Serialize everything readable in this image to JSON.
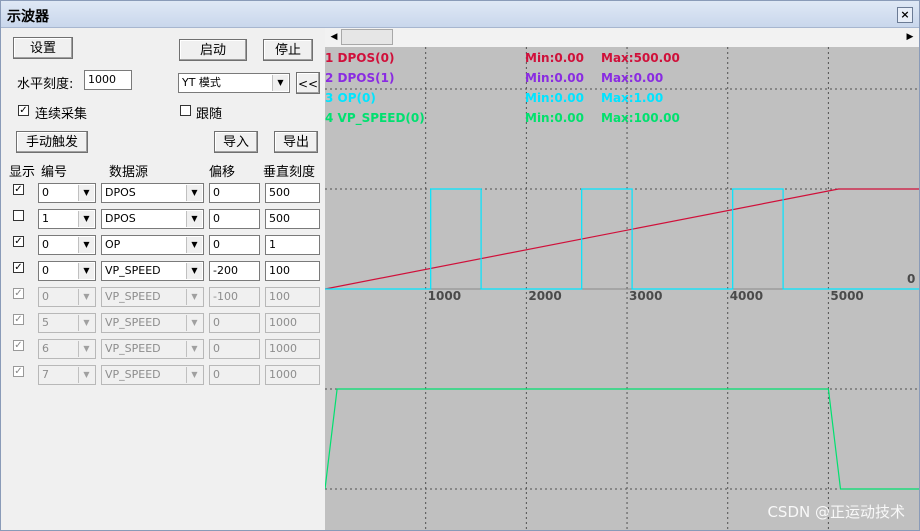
{
  "window": {
    "title": "示波器",
    "close_label": "×"
  },
  "toolbar": {
    "settings_label": "设置",
    "start_label": "启动",
    "stop_label": "停止",
    "h_scale_label": "水平刻度:",
    "h_scale_value": "1000",
    "mode_value": "YT 模式",
    "collapse_label": "<<",
    "continuous_label": "连续采集",
    "continuous_checked": true,
    "follow_label": "跟随",
    "follow_checked": false,
    "manual_trigger_label": "手动触发",
    "import_label": "导入",
    "export_label": "导出"
  },
  "columns": {
    "show": "显示",
    "num": "编号",
    "source": "数据源",
    "offset": "偏移",
    "scale": "垂直刻度"
  },
  "channels": [
    {
      "show": true,
      "num": "0",
      "source": "DPOS",
      "offset": "0",
      "scale": "500",
      "enabled": true
    },
    {
      "show": false,
      "num": "1",
      "source": "DPOS",
      "offset": "0",
      "scale": "500",
      "enabled": true
    },
    {
      "show": true,
      "num": "0",
      "source": "OP",
      "offset": "0",
      "scale": "1",
      "enabled": true
    },
    {
      "show": true,
      "num": "0",
      "source": "VP_SPEED",
      "offset": "-200",
      "scale": "100",
      "enabled": true
    },
    {
      "show": true,
      "num": "0",
      "source": "VP_SPEED",
      "offset": "-100",
      "scale": "100",
      "enabled": false
    },
    {
      "show": true,
      "num": "5",
      "source": "VP_SPEED",
      "offset": "0",
      "scale": "1000",
      "enabled": false
    },
    {
      "show": true,
      "num": "6",
      "source": "VP_SPEED",
      "offset": "0",
      "scale": "1000",
      "enabled": false
    },
    {
      "show": true,
      "num": "7",
      "source": "VP_SPEED",
      "offset": "0",
      "scale": "1000",
      "enabled": false
    }
  ],
  "legend": [
    {
      "name": "1 DPOS(0)",
      "min": "Min:0.00",
      "max": "Max:500.00",
      "color": "#d0103a"
    },
    {
      "name": "2 DPOS(1)",
      "min": "Min:0.00",
      "max": "Max:0.00",
      "color": "#8a2be2"
    },
    {
      "name": "3 OP(0)",
      "min": "Min:0.00",
      "max": "Max:1.00",
      "color": "#00e5ff"
    },
    {
      "name": "4 VP_SPEED(0)",
      "min": "Min:0.00",
      "max": "Max:100.00",
      "color": "#00e070"
    }
  ],
  "scope": {
    "background": "#c0c0c0",
    "grid_color": "#505050",
    "x_ticks": [
      "1000",
      "2000",
      "3000",
      "4000",
      "5000"
    ],
    "zero_label": "0"
  },
  "watermark": "CSDN @正运动技术",
  "chart_data": {
    "type": "line",
    "x_range": [
      0,
      5900
    ],
    "series": [
      {
        "name": "1 DPOS(0)",
        "color": "#d0103a",
        "ymax": 500,
        "points": [
          [
            0,
            0
          ],
          [
            5100,
            500
          ],
          [
            5900,
            500
          ]
        ]
      },
      {
        "name": "3 OP(0)",
        "color": "#00e5ff",
        "ymax": 1,
        "points": [
          [
            0,
            0
          ],
          [
            1050,
            0
          ],
          [
            1050,
            1
          ],
          [
            1550,
            1
          ],
          [
            1550,
            0
          ],
          [
            2550,
            0
          ],
          [
            2550,
            1
          ],
          [
            3050,
            1
          ],
          [
            3050,
            0
          ],
          [
            4050,
            0
          ],
          [
            4050,
            1
          ],
          [
            4550,
            1
          ],
          [
            4550,
            0
          ],
          [
            5900,
            0
          ]
        ]
      },
      {
        "name": "4 VP_SPEED(0)",
        "color": "#00e070",
        "ymax": 100,
        "points": [
          [
            0,
            0
          ],
          [
            120,
            100
          ],
          [
            5000,
            100
          ],
          [
            5120,
            0
          ],
          [
            5900,
            0
          ]
        ]
      }
    ]
  }
}
